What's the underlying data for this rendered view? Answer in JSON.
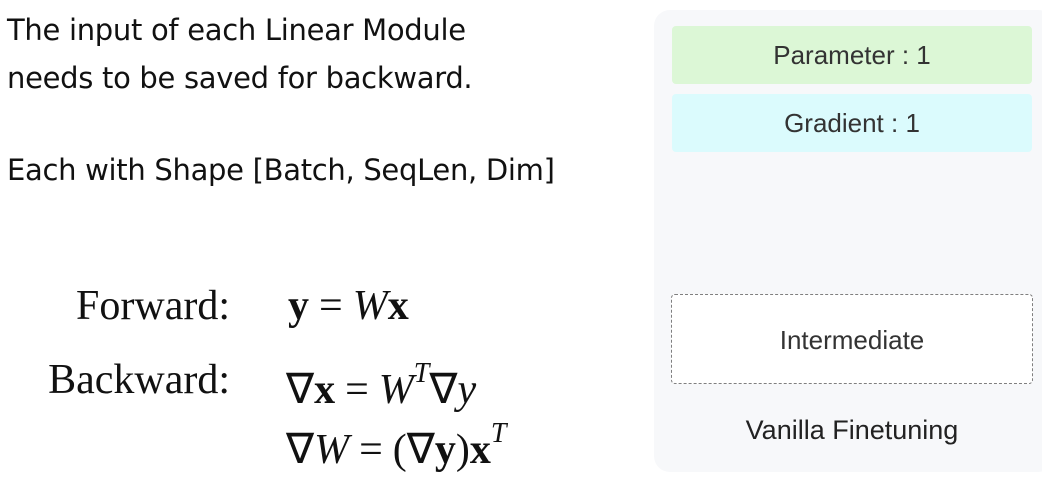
{
  "intro": {
    "line1": "The input of each Linear Module",
    "line2": "needs to be saved for backward.",
    "shape_note": "Each with Shape [Batch, SeqLen, Dim]"
  },
  "equations": {
    "forward_label": "Forward:",
    "backward_label": "Backward:",
    "forward": {
      "lhs": "y",
      "eq": "=",
      "w": "W",
      "x": "x"
    },
    "backward_x": {
      "nabla": "∇",
      "x": "x",
      "eq": "=",
      "w": "W",
      "t": "T",
      "y": "y"
    },
    "backward_w": {
      "nabla": "∇",
      "w": "W",
      "eq": "=",
      "open": "(",
      "y": "y",
      "close": ")",
      "x": "x",
      "t": "T"
    }
  },
  "memory": {
    "parameter": "Parameter : 1",
    "gradient": "Gradient : 1",
    "intermediate": "Intermediate",
    "caption": "Vanilla Finetuning",
    "colors": {
      "parameter_bg": "#dcf7d6",
      "gradient_bg": "#dbfbfd",
      "panel_bg": "#f7f8fa",
      "dashed_border": "#7f7f7f"
    }
  }
}
